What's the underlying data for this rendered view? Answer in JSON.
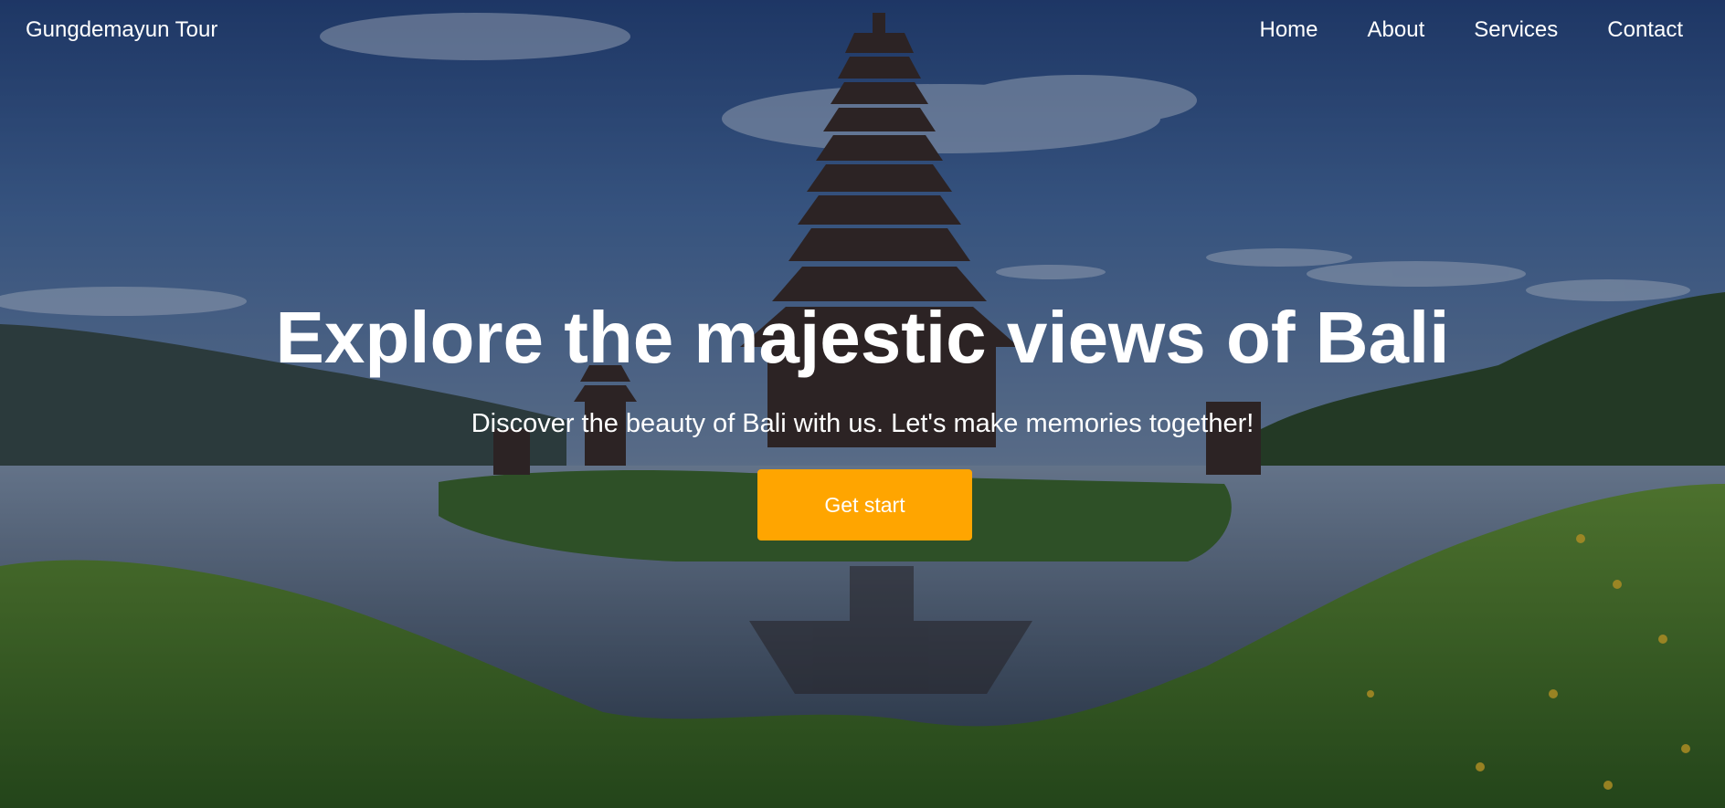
{
  "brand": {
    "name": "Gungdemayun Tour"
  },
  "nav": {
    "items": [
      {
        "label": "Home"
      },
      {
        "label": "About"
      },
      {
        "label": "Services"
      },
      {
        "label": "Contact"
      }
    ]
  },
  "hero": {
    "title": "Explore the majestic views of Bali",
    "subtitle": "Discover the beauty of Bali with us. Let's make memories together!",
    "button_label": "Get start",
    "background_image": "bali-temple-lake-photo"
  },
  "colors": {
    "accent": "#ffa500",
    "text": "#ffffff"
  }
}
